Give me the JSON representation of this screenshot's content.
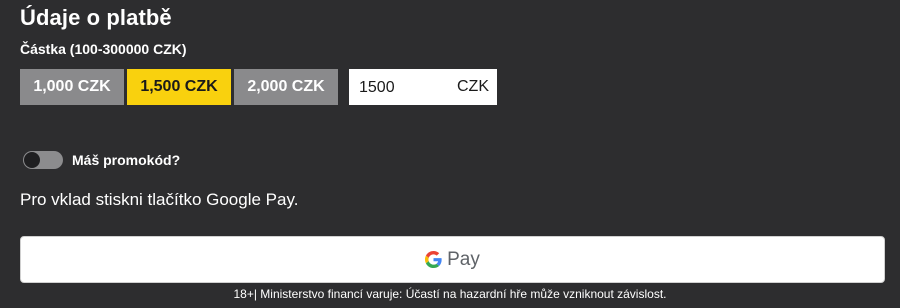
{
  "payment": {
    "title": "Údaje o platbě",
    "amount_label": "Částka (100-300000 CZK)",
    "presets": [
      {
        "label": "1,000 CZK",
        "selected": false
      },
      {
        "label": "1,500 CZK",
        "selected": true
      },
      {
        "label": "2,000 CZK",
        "selected": false
      }
    ],
    "amount_value": "1500",
    "currency": "CZK"
  },
  "promo": {
    "label": "Máš promokód?",
    "enabled": false
  },
  "instruction": "Pro vklad stiskni tlačítko Google Pay.",
  "gpay": {
    "label": "Pay",
    "icon": "google-g-icon"
  },
  "footer": "18+| Ministerstvo financí varuje: Účastí na hazardní hře může vzniknout závislost.",
  "colors": {
    "background": "#2d2d2f",
    "selected": "#f9d10e",
    "unselected": "#8a8a8c"
  }
}
